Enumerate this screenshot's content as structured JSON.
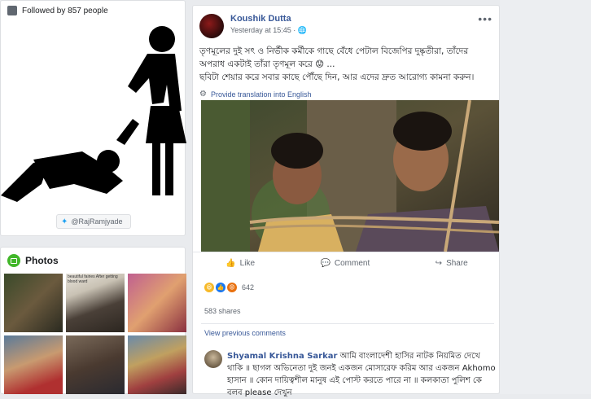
{
  "left": {
    "followed_text": "Followed by 857 people",
    "twitter_handle": "@RajRamjyade",
    "photos_title": "Photos",
    "photo_captions": [
      "",
      "beautiful fairies After getting blood ward",
      "",
      "",
      "",
      ""
    ]
  },
  "post": {
    "author": "Koushik Dutta",
    "timestamp": "Yesterday at 15:45",
    "text_line1": "তৃণমূলের দুই সৎ ও নির্ভীক কর্মীকে গাছে বেঁধে পেটাল বিজেপির দুষ্কৃতীরা, তাঁদের অপরাধ একটাই তাঁরা তৃণমূল করে 😟 ...",
    "text_line2": "ছবিটা শেয়ার করে সবার কাছে পৌঁছে দিন, আর এদের দ্রুত আরোগ্য কামনা করুন।",
    "translate_label": "Provide translation into English",
    "actions": {
      "like": "Like",
      "comment": "Comment",
      "share": "Share"
    },
    "reaction_count": "642",
    "shares": "583 shares",
    "view_previous": "View previous comments",
    "comment": {
      "name": "Shyamal Krishna Sarkar",
      "text": "আমি বাংলাদেশী হাসির নাটক নিয়মিত দেখে থাকি ॥ ছাগল অভিনেতা দুই জনই একজন মোসারেফ করিম আর একজন Akhomo হাসান ॥ কোন দায়িত্বশীল মানুষ এই পোস্ট করতে পারে না ॥ কলকাতা পুলিশ কে বলব please দেখুন"
    }
  },
  "colors": {
    "link": "#385898",
    "background": "#e9ebee",
    "like_blue": "#1877f2",
    "haha_yellow": "#f7b928",
    "angry_red": "#e9710f"
  }
}
